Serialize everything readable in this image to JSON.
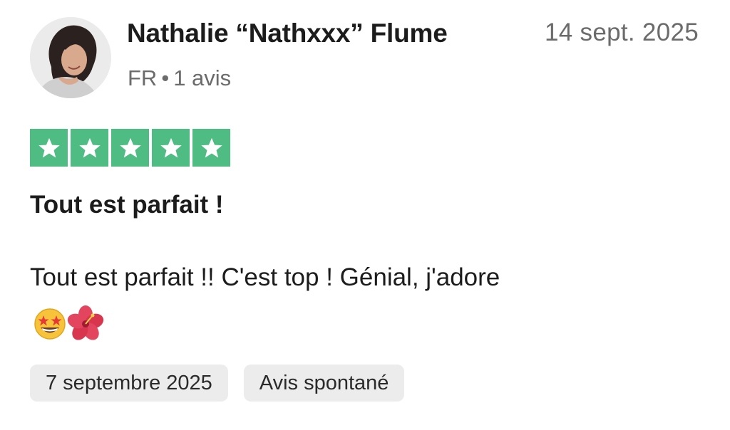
{
  "review": {
    "author_name": "Nathalie “Nathxxx” Flume",
    "date": "14 sept. 2025",
    "country": "FR",
    "separator": "•",
    "review_count": "1 avis",
    "rating": 5,
    "rating_max": 5,
    "title": "Tout est parfait !",
    "text": "Tout est parfait !! C'est top ! Génial, j'adore",
    "emojis": [
      "star-struck-emoji",
      "hibiscus-emoji"
    ],
    "tags": [
      "7 septembre 2025",
      "Avis spontané"
    ]
  },
  "colors": {
    "star_green": "#4fbd83",
    "muted_text": "#6b6b6b",
    "chip_bg": "#ececec"
  }
}
